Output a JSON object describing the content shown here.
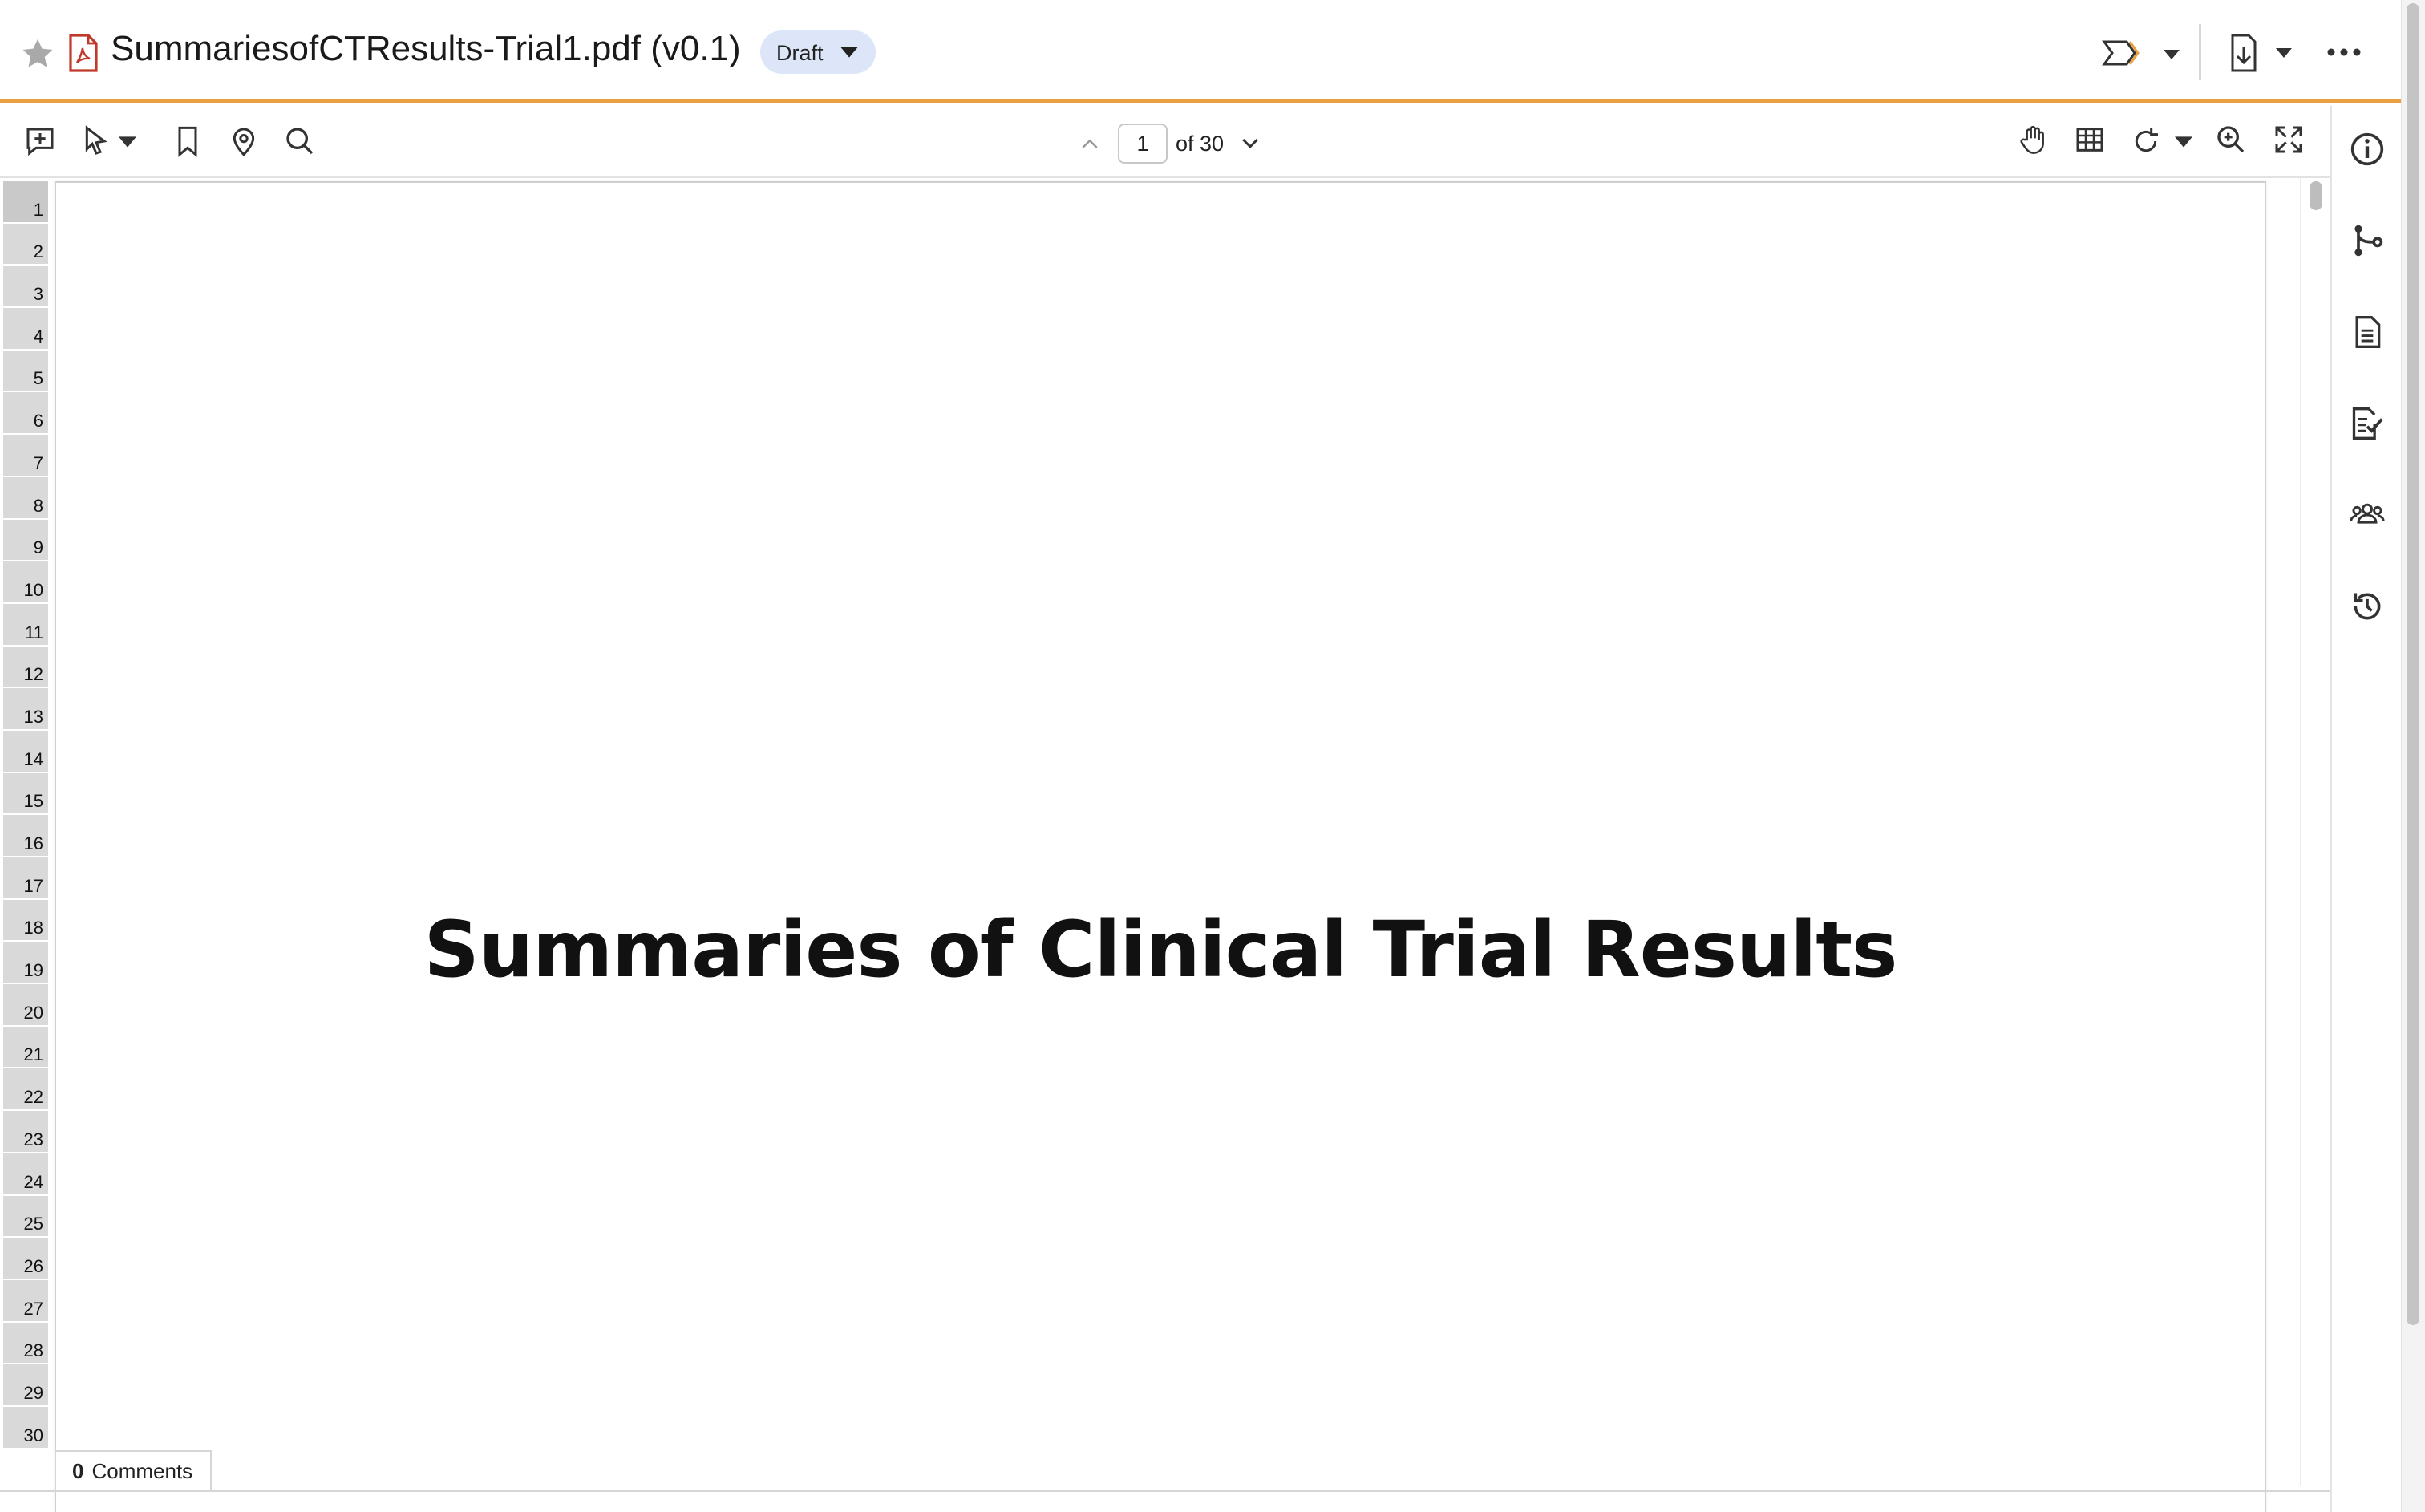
{
  "header": {
    "title": "SummariesofCTResults-Trial1.pdf (v0.1)",
    "status": "Draft",
    "accent_color": "#e8a040",
    "icons": {
      "favorite": "star-icon",
      "file_type": "pdf-icon",
      "workflow": "workflow-icon",
      "download": "download-icon",
      "more": "more-icon"
    }
  },
  "toolbar": {
    "tools": [
      "add-comment-icon",
      "select-tool-icon",
      "bookmark-icon",
      "location-pin-icon",
      "search-icon"
    ],
    "page_current": "1",
    "page_total_label": "of 30",
    "view_tools": [
      "pan-hand-icon",
      "grid-view-icon",
      "rotate-icon",
      "zoom-in-icon",
      "fullscreen-icon"
    ]
  },
  "right_rail": {
    "items": [
      "info-icon",
      "relationships-icon",
      "document-icon",
      "tasks-icon",
      "members-icon",
      "history-icon"
    ]
  },
  "line_numbers": [
    "1",
    "2",
    "3",
    "4",
    "5",
    "6",
    "7",
    "8",
    "9",
    "10",
    "11",
    "12",
    "13",
    "14",
    "15",
    "16",
    "17",
    "18",
    "19",
    "20",
    "21",
    "22",
    "23",
    "24",
    "25",
    "26",
    "27",
    "28",
    "29",
    "30"
  ],
  "document": {
    "heading": "Summaries of Clinical Trial Results"
  },
  "comments": {
    "count": "0",
    "label": "Comments"
  }
}
